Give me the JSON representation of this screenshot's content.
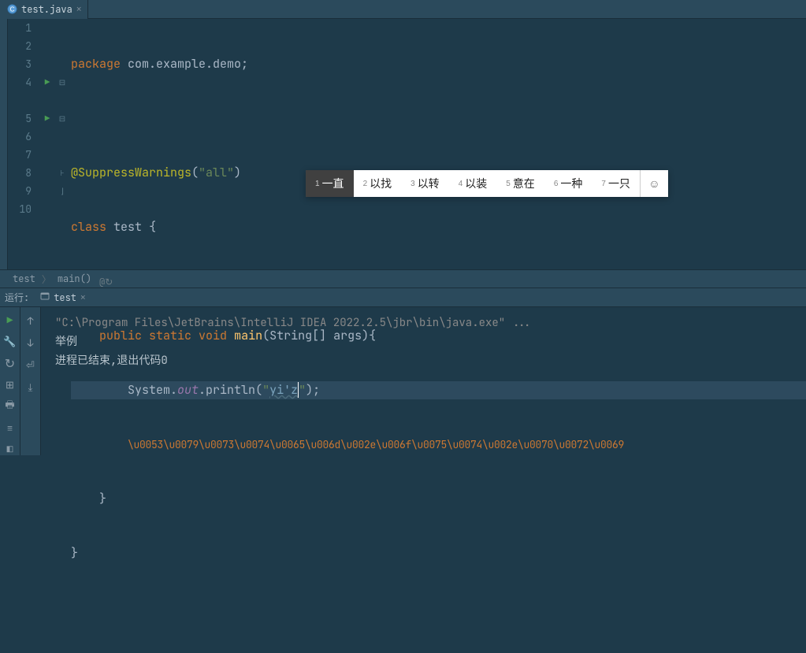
{
  "tab": {
    "filename": "test.java"
  },
  "code": {
    "line1": {
      "pkg": "package",
      "name": "com.example.demo"
    },
    "line3": {
      "ann": "@SuppressWarnings",
      "arg": "\"all\""
    },
    "line4": {
      "kw": "class",
      "name": "test",
      "brace": "{"
    },
    "line5": {
      "mod": "public static",
      "ret": "void",
      "fn": "main",
      "args": "(String[] args){"
    },
    "line6": {
      "sys": "System.",
      "out": "out",
      "print": ".println(",
      "q1": "\"",
      "typed": "yi'z",
      "q2": "\"",
      "end": ");"
    },
    "line7_escapes": "\\u0053\\u0079\\u0073\\u0074\\u0065\\u006d\\u002e\\u006f\\u0075\\u0074\\u002e\\u0070\\u0072\\u0069",
    "line8": "}",
    "line9": "}"
  },
  "ime": {
    "candidates": [
      {
        "n": "1",
        "t": "一直"
      },
      {
        "n": "2",
        "t": "以找"
      },
      {
        "n": "3",
        "t": "以转"
      },
      {
        "n": "4",
        "t": "以装"
      },
      {
        "n": "5",
        "t": "意在"
      },
      {
        "n": "6",
        "t": "一种"
      },
      {
        "n": "7",
        "t": "一只"
      }
    ]
  },
  "breadcrumb": {
    "items": [
      "test",
      "main()"
    ]
  },
  "run": {
    "header_label": "运行:",
    "tab_label": "test",
    "console_lines": [
      "\"C:\\Program Files\\JetBrains\\IntelliJ IDEA 2022.2.5\\jbr\\bin\\java.exe\" ...",
      "举例",
      "",
      "进程已结束,退出代码0"
    ]
  }
}
